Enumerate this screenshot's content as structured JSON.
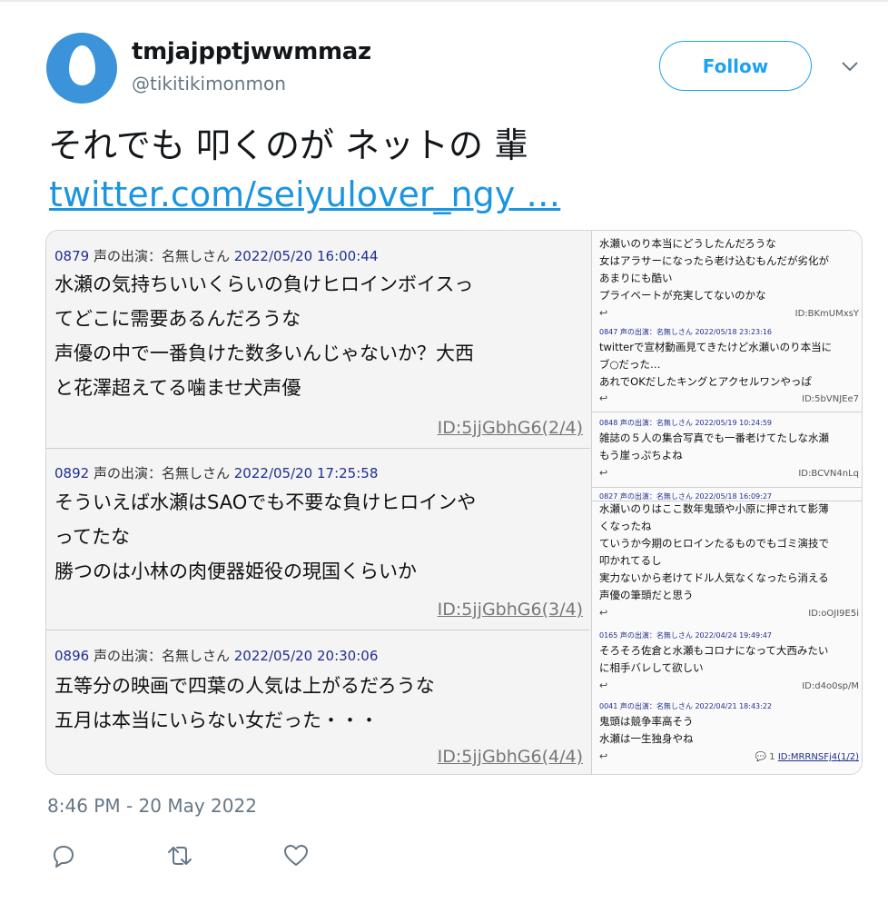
{
  "tweet": {
    "display_name": "tmjajpptjwwmmaz",
    "handle": "@tikitikimonmon",
    "follow_label": "Follow",
    "text": "それでも 叩くのが ネットの 輩",
    "link": "twitter.com/seiyulover_ngy …",
    "timestamp": "8:46 PM - 20 May 2022"
  },
  "media": {
    "left_posts": [
      {
        "num": "0879",
        "meta": "声の出演：名無しさん",
        "date": "2022/05/20 16:00:44",
        "lines": [
          "水瀬の気持ちいいくらいの負けヒロインボイスっ",
          "てどこに需要あるんだろうな",
          "声優の中で一番負けた数多いんじゃないか？大西",
          "と花澤超えてる噛ませ犬声優"
        ],
        "id": "ID:5jjGbhG6(2/4)"
      },
      {
        "num": "0892",
        "meta": "声の出演：名無しさん",
        "date": "2022/05/20 17:25:58",
        "lines": [
          "そういえば水瀬はSAOでも不要な負けヒロインや",
          "ってたな",
          "勝つのは小林の肉便器姫役の現国くらいか"
        ],
        "id": "ID:5jjGbhG6(3/4)"
      },
      {
        "num": "0896",
        "meta": "声の出演：名無しさん",
        "date": "2022/05/20 20:30:06",
        "lines": [
          "五等分の映画で四葉の人気は上がるだろうな",
          "五月は本当にいらない女だった・・・"
        ],
        "id": "ID:5jjGbhG6(4/4)"
      }
    ],
    "right_posts": [
      {
        "header": "",
        "lines": [
          "水瀬いのり本当にどうしたんだろうな",
          "女はアラサーになったら老け込むもんだが劣化が",
          "あまりにも酷い",
          "プライベートが充実してないのかな"
        ],
        "id": "ID:BKmUMxsY"
      },
      {
        "header": "0847 声の出演：名無しさん 2022/05/18 23:23:16",
        "lines": [
          "twitterで宣材動画見てきたけど水瀬いのり本当に",
          "ブ○だった…",
          "あれでOKだしたキングとアクセルワンやっぱ"
        ],
        "id": "ID:5bVNJEe7"
      },
      {
        "header": "0848 声の出演：名無しさん 2022/05/19 10:24:59",
        "lines": [
          "雑誌の５人の集合写真でも一番老けてたしな水瀬",
          "もう崖っぷちよね"
        ],
        "id": "ID:BCVN4nLq"
      },
      {
        "header": "0827 声の出演：名無しさん 2022/05/18 16:09:27",
        "lines": [
          "水瀬いのりはここ数年鬼頭や小原に押されて影薄",
          "くなったね",
          "ていうか今期のヒロインたるものでもゴミ演技で",
          "叩かれてるし",
          "実力ないから老けてドル人気なくなったら消える",
          "声優の筆頭だと思う"
        ],
        "id": "ID:oOJI9E5i"
      },
      {
        "header": "0165 声の出演：名無しさん 2022/04/24 19:49:47",
        "lines": [
          "そろそろ佐倉と水瀬もコロナになって大西みたい",
          "に相手バレして欲しい"
        ],
        "id": "ID:d4o0sp/M"
      },
      {
        "header": "0041 声の出演：名無しさん 2022/04/21 18:43:22",
        "lines": [
          "鬼頭は競争率高そう",
          "水瀬は一生独身やね"
        ],
        "id": "ID:MRRNSFj4(1/2)",
        "reply_count": "1"
      }
    ]
  },
  "icons": {
    "reply": "reply-icon",
    "retweet": "retweet-icon",
    "like": "like-icon",
    "caret": "chevron-down-icon"
  },
  "colors": {
    "accent": "#1da1f2",
    "link": "#1b95e0",
    "muted": "#657786",
    "post_meta": "#1f2f8f"
  }
}
